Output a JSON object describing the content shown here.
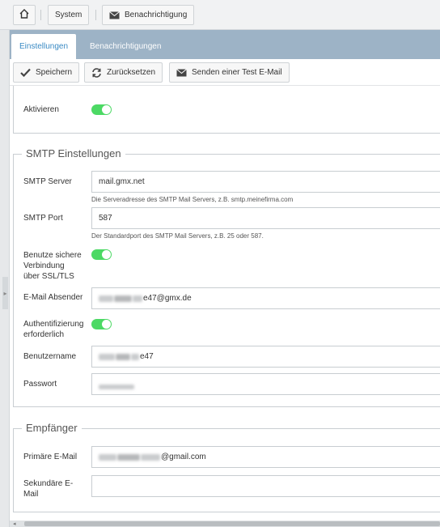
{
  "breadcrumb": {
    "home_icon": "home-icon",
    "system": "System",
    "notification": "Benachrichtigung",
    "notification_icon": "envelope-icon"
  },
  "tabs": [
    {
      "label": "Einstellungen",
      "active": true
    },
    {
      "label": "Benachrichtigungen",
      "active": false
    }
  ],
  "toolbar": {
    "save": "Speichern",
    "reset": "Zurücksetzen",
    "test_mail": "Senden einer Test E-Mail"
  },
  "activate": {
    "label": "Aktivieren",
    "enabled": true
  },
  "smtp": {
    "legend": "SMTP Einstellungen",
    "server_label": "SMTP Server",
    "server_value": "mail.gmx.net",
    "server_hint": "Die Serveradresse des SMTP Mail Servers, z.B. smtp.meinefirma.com",
    "port_label": "SMTP Port",
    "port_value": "587",
    "port_hint": "Der Standardport des SMTP Mail Servers, z.B. 25 oder 587.",
    "ssl_label_1": "Benutze sichere",
    "ssl_label_2": "Verbindung",
    "ssl_label_3": "über SSL/TLS",
    "ssl_enabled": true,
    "sender_label": "E-Mail Absender",
    "sender_suffix": "e47@gmx.de",
    "auth_label_1": "Authentifizierung",
    "auth_label_2": "erforderlich",
    "auth_enabled": true,
    "user_label": "Benutzername",
    "user_suffix": "e47",
    "password_label": "Passwort"
  },
  "recipient": {
    "legend": "Empfänger",
    "primary_label": "Primäre E-Mail",
    "primary_suffix": "@gmail.com",
    "secondary_label_1": "Sekundäre E-",
    "secondary_label_2": "Mail",
    "secondary_value": ""
  },
  "colors": {
    "tab_strip": "#9db3c6",
    "active_tab_text": "#3a8ac4",
    "toggle_on": "#4cd964"
  }
}
